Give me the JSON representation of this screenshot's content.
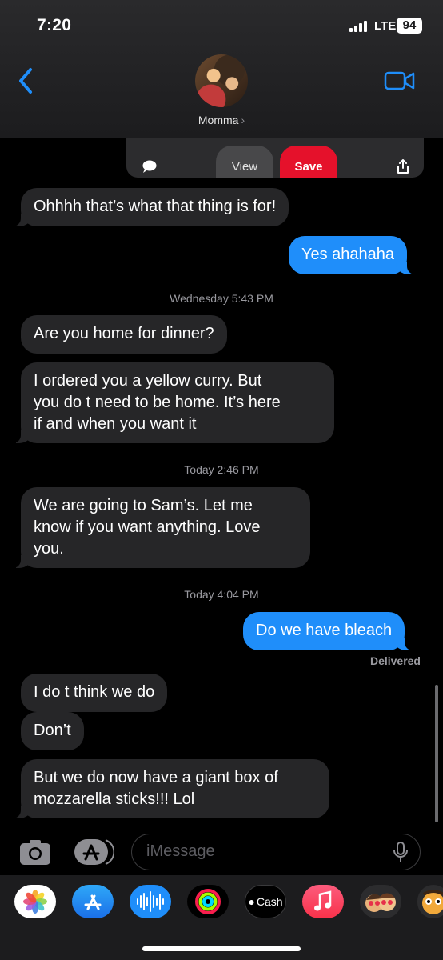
{
  "status_bar": {
    "time": "7:20",
    "network": "LTE",
    "battery": "94"
  },
  "header": {
    "contact_name": "Momma",
    "chevron": "›"
  },
  "attachment_card": {
    "view_label": "View",
    "save_label": "Save"
  },
  "messages": [
    {
      "text": "Ohhhh that’s what that thing is for!"
    },
    {
      "text": "Yes ahahaha"
    },
    {
      "text": "Are you home for dinner?"
    },
    {
      "text": "I ordered you a yellow curry. But\nyou do t need to be home. It’s here\nif and when you want it"
    },
    {
      "text": "We are going to Sam’s. Let me\nknow if you want anything. Love\nyou."
    },
    {
      "text": "Do we have bleach"
    },
    {
      "text": "I do t think we do"
    },
    {
      "text": "Don’t"
    },
    {
      "text": "But we do now have a giant box of\nmozzarella sticks!!! Lol"
    }
  ],
  "timestamps": [
    {
      "day": "Wednesday",
      "time": "5:43 PM"
    },
    {
      "day": "Today",
      "time": "2:46 PM"
    },
    {
      "day": "Today",
      "time": "4:04 PM"
    }
  ],
  "delivery_status": "Delivered",
  "composer": {
    "placeholder": "iMessage"
  },
  "app_drawer": {
    "apps": [
      {
        "name": "photos-app-icon"
      },
      {
        "name": "app-store-app-icon"
      },
      {
        "name": "audio-message-app-icon"
      },
      {
        "name": "fitness-app-icon"
      },
      {
        "name": "apple-cash-app-icon",
        "label": "Cash"
      },
      {
        "name": "music-app-icon"
      },
      {
        "name": "memoji-stickers-app-icon"
      },
      {
        "name": "animoji-app-icon"
      }
    ]
  },
  "colors": {
    "outgoing_bubble": "#1f8efa",
    "incoming_bubble": "#262628",
    "accent": "#1f8efa",
    "save_button": "#e5112b"
  }
}
